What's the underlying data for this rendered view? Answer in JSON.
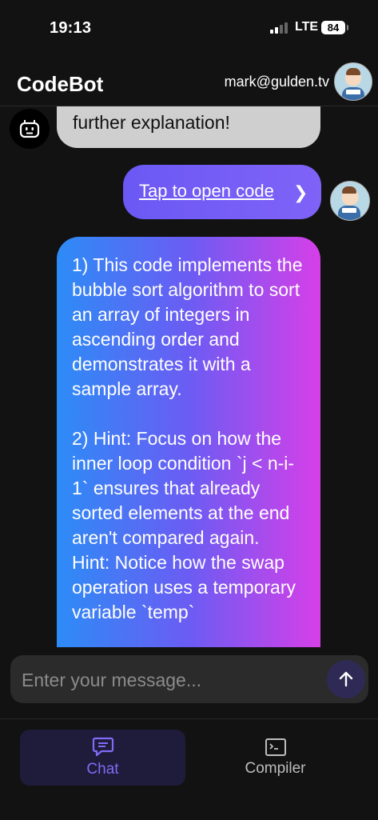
{
  "status_bar": {
    "time": "19:13",
    "network": "LTE",
    "battery": "84"
  },
  "header": {
    "title": "CodeBot",
    "email": "mark@gulden.tv"
  },
  "messages": {
    "bot_partial": "further explanation!",
    "user_link": "Tap to open code",
    "user_chevron": "❯",
    "bot_response": {
      "p1": "1) This code implements the bubble sort algorithm to sort an array of integers in ascending order and demonstrates it with a sample array.",
      "p2": "2) Hint: Focus on how the inner loop condition `j < n-i-1` ensures that already sorted elements at the end aren't compared again.",
      "p3": "Hint: Notice how the swap operation uses a temporary variable `temp`"
    }
  },
  "input": {
    "placeholder": "Enter your message..."
  },
  "tabs": {
    "chat": "Chat",
    "compiler": "Compiler"
  },
  "colors": {
    "accent": "#7f6cf5",
    "user_bubble": "#6b58f4",
    "bot_bubble_gray": "#cfcfcf",
    "gradient_start": "#2c8cf6",
    "gradient_end": "#d63fe8"
  },
  "icons": {
    "status": [
      "signal-icon",
      "battery-icon"
    ],
    "bot_avatar": "robot-icon",
    "send": "arrow-up-icon",
    "chat_tab": "chat-bubble-icon",
    "compiler_tab": "terminal-icon"
  }
}
